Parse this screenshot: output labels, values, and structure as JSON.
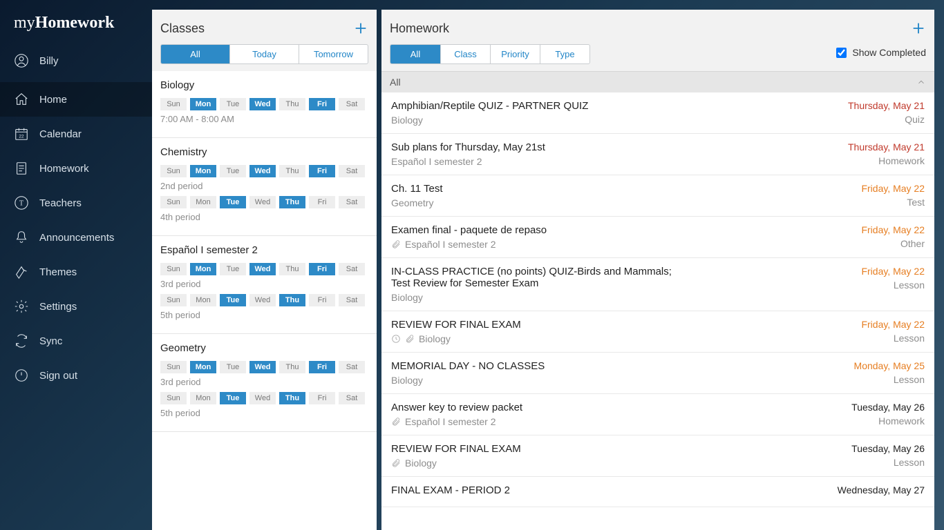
{
  "brand": {
    "prefix": "my",
    "main": "Homework"
  },
  "user": {
    "name": "Billy"
  },
  "nav": [
    {
      "id": "home",
      "label": "Home",
      "active": true
    },
    {
      "id": "calendar",
      "label": "Calendar"
    },
    {
      "id": "homework",
      "label": "Homework"
    },
    {
      "id": "teachers",
      "label": "Teachers"
    },
    {
      "id": "announcements",
      "label": "Announcements"
    },
    {
      "id": "themes",
      "label": "Themes"
    },
    {
      "id": "settings",
      "label": "Settings"
    },
    {
      "id": "sync",
      "label": "Sync"
    },
    {
      "id": "signout",
      "label": "Sign out"
    }
  ],
  "classes": {
    "header": "Classes",
    "seg": [
      "All",
      "Today",
      "Tomorrow"
    ],
    "seg_active": 0,
    "items": [
      {
        "name": "Biology",
        "schedules": [
          {
            "days": [
              0,
              1,
              0,
              1,
              0,
              1,
              0
            ],
            "meta": "7:00 AM - 8:00 AM"
          }
        ]
      },
      {
        "name": "Chemistry",
        "schedules": [
          {
            "days": [
              0,
              1,
              0,
              1,
              0,
              1,
              0
            ],
            "meta": "2nd period"
          },
          {
            "days": [
              0,
              0,
              1,
              0,
              1,
              0,
              0
            ],
            "meta": "4th period"
          }
        ]
      },
      {
        "name": "Español I semester 2",
        "schedules": [
          {
            "days": [
              0,
              1,
              0,
              1,
              0,
              1,
              0
            ],
            "meta": "3rd period"
          },
          {
            "days": [
              0,
              0,
              1,
              0,
              1,
              0,
              0
            ],
            "meta": "5th period"
          }
        ]
      },
      {
        "name": "Geometry",
        "schedules": [
          {
            "days": [
              0,
              1,
              0,
              1,
              0,
              1,
              0
            ],
            "meta": "3rd period"
          },
          {
            "days": [
              0,
              0,
              1,
              0,
              1,
              0,
              0
            ],
            "meta": "5th period"
          }
        ]
      }
    ],
    "day_labels": [
      "Sun",
      "Mon",
      "Tue",
      "Wed",
      "Thu",
      "Fri",
      "Sat"
    ]
  },
  "homework": {
    "header": "Homework",
    "seg": [
      "All",
      "Class",
      "Priority",
      "Type"
    ],
    "seg_active": 0,
    "show_completed": {
      "label": "Show Completed",
      "checked": true
    },
    "section": "All",
    "items": [
      {
        "title": "Amphibian/Reptile QUIZ - PARTNER QUIZ",
        "subject": "Biology",
        "date": "Thursday, May 21",
        "type": "Quiz",
        "cls": "overdue",
        "attach": false,
        "clock": false
      },
      {
        "title": "Sub plans for Thursday, May 21st",
        "subject": "Español I semester 2",
        "date": "Thursday, May 21",
        "type": "Homework",
        "cls": "overdue",
        "attach": false,
        "clock": false
      },
      {
        "title": "Ch. 11 Test",
        "subject": "Geometry",
        "date": "Friday, May 22",
        "type": "Test",
        "cls": "soon",
        "attach": false,
        "clock": false
      },
      {
        "title": "Examen final - paquete de repaso",
        "subject": "Español I semester 2",
        "date": "Friday, May 22",
        "type": "Other",
        "cls": "soon",
        "attach": true,
        "clock": false
      },
      {
        "title": "IN-CLASS PRACTICE (no points) QUIZ-Birds and Mammals;\nTest Review for Semester Exam",
        "subject": "Biology",
        "date": "Friday, May 22",
        "type": "Lesson",
        "cls": "soon",
        "attach": false,
        "clock": false
      },
      {
        "title": "REVIEW FOR FINAL EXAM",
        "subject": "Biology",
        "date": "Friday, May 22",
        "type": "Lesson",
        "cls": "soon",
        "attach": true,
        "clock": true
      },
      {
        "title": "MEMORIAL DAY - NO CLASSES",
        "subject": "Biology",
        "date": "Monday, May 25",
        "type": "Lesson",
        "cls": "soon",
        "attach": false,
        "clock": false
      },
      {
        "title": "Answer key to review packet",
        "subject": "Español I semester 2",
        "date": "Tuesday, May 26",
        "type": "Homework",
        "cls": "normal",
        "attach": true,
        "clock": false
      },
      {
        "title": "REVIEW FOR FINAL EXAM",
        "subject": "Biology",
        "date": "Tuesday, May 26",
        "type": "Lesson",
        "cls": "normal",
        "attach": true,
        "clock": false
      },
      {
        "title": "FINAL EXAM - PERIOD 2",
        "subject": "",
        "date": "Wednesday, May 27",
        "type": "",
        "cls": "normal",
        "attach": false,
        "clock": false
      }
    ]
  }
}
